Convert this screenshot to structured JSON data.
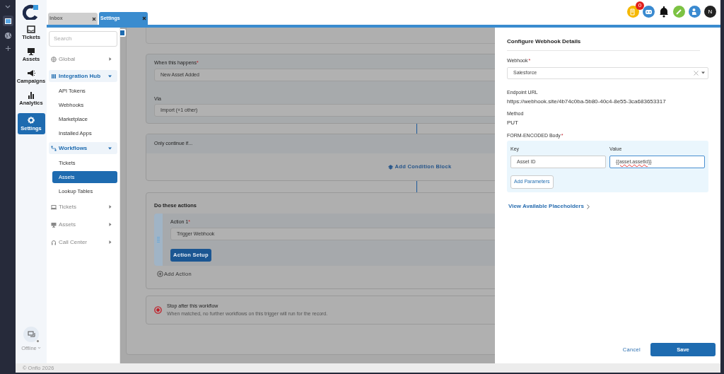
{
  "rail": {
    "items": [
      {
        "label": "Tickets",
        "selected": false
      },
      {
        "label": "Assets",
        "selected": false
      },
      {
        "label": "Campaigns",
        "selected": false
      },
      {
        "label": "Analytics",
        "selected": false
      },
      {
        "label": "Settings",
        "selected": true
      }
    ],
    "chat_status": "Offline"
  },
  "tabs": [
    {
      "label": "Inbox",
      "selected": false
    },
    {
      "label": "Settings",
      "selected": true
    }
  ],
  "header": {
    "notification_count": "0",
    "avatar": "N"
  },
  "settings_menu": {
    "search": {
      "placeholder": "Search"
    },
    "groups": [
      {
        "label": "Global",
        "expanded": false
      },
      {
        "label": "Integration Hub",
        "expanded": true,
        "children": [
          {
            "label": "API Tokens",
            "selected": false
          },
          {
            "label": "Webhooks",
            "selected": false
          },
          {
            "label": "Marketplace",
            "selected": false
          },
          {
            "label": "Installed Apps",
            "selected": false
          }
        ]
      },
      {
        "label": "Workflows",
        "expanded": true,
        "children": [
          {
            "label": "Tickets",
            "selected": false
          },
          {
            "label": "Assets",
            "selected": true
          },
          {
            "label": "Lookup Tables",
            "selected": false
          }
        ]
      },
      {
        "label": "Tickets",
        "expanded": false
      },
      {
        "label": "Assets",
        "expanded": false
      },
      {
        "label": "Call Center",
        "expanded": false
      }
    ]
  },
  "workflow": {
    "trigger": {
      "label": "When this happens",
      "required_mark": "*",
      "value": "New Asset Added",
      "via_label": "Via",
      "via_value": "Import (+1 other)"
    },
    "conditions": {
      "title": "Only continue if...",
      "add_label": "Add Condition Block"
    },
    "actions": {
      "title": "Do these actions",
      "items": [
        {
          "label": "Action 1",
          "required_mark": "*",
          "value": "Trigger Webhook",
          "button": "Action Setup"
        }
      ],
      "add_label": "Add Action"
    },
    "stop": {
      "title": "Stop after this workflow",
      "description": "When matched, no further workflows on this trigger will run for the record.",
      "on": true
    }
  },
  "drawer": {
    "title": "Configure Webhook Details",
    "webhook": {
      "label": "Webhook",
      "required_mark": "*",
      "value": "Salesforce"
    },
    "endpoint": {
      "label": "Endpoint URL",
      "value": "https://webhook.site/4b74c0ba-5b80-40c4-8e55-3ca683653317"
    },
    "method": {
      "label": "Method",
      "value": "PUT"
    },
    "body": {
      "label": "FORM-ENCODED Body",
      "required_mark": "*",
      "key_label": "Key",
      "value_label": "Value",
      "params": [
        {
          "key": "Asset ID",
          "value": "{{asset.assetId}}",
          "focused": true
        }
      ],
      "add_button": "Add Parameters"
    },
    "placeholders_link": "View Available Placeholders",
    "cancel": "Cancel",
    "save": "Save"
  },
  "footer": "© Onflo 2026"
}
